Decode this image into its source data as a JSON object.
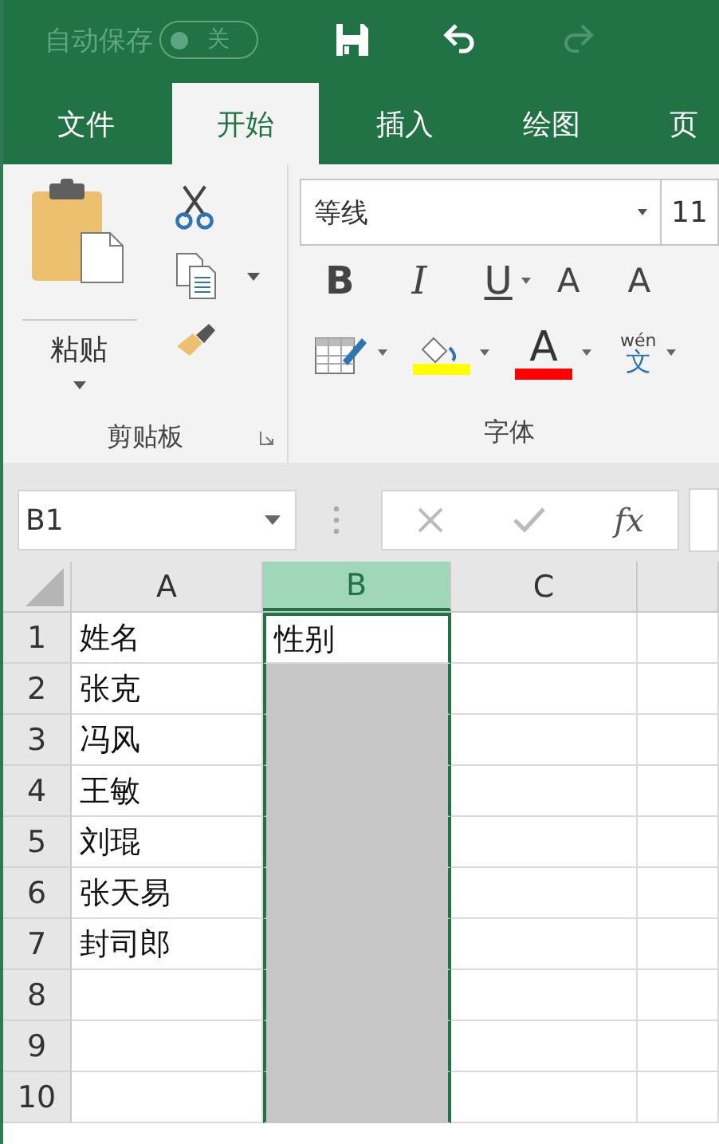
{
  "title_bar": {
    "autosave_label": "自动保存",
    "autosave_on": false,
    "autosave_state": "关",
    "redo_disabled": true
  },
  "tabs": [
    {
      "label": "文件",
      "selected": false
    },
    {
      "label": "开始",
      "selected": true
    },
    {
      "label": "插入",
      "selected": false
    },
    {
      "label": "绘图",
      "selected": false
    },
    {
      "label": "页",
      "selected": false
    }
  ],
  "ribbon": {
    "clipboard": {
      "paste_label": "粘贴",
      "group_label": "剪贴板"
    },
    "font": {
      "font_name": "等线",
      "font_size": "11",
      "bold": "B",
      "italic": "I",
      "underline": "U",
      "grow": "A",
      "shrink": "A",
      "phonetic_top": "wén",
      "phonetic_bottom": "文",
      "font_color_glyph": "A",
      "group_label": "字体",
      "swatches": [
        {
          "kind": "fill",
          "color": "#ffff00"
        },
        {
          "kind": "font",
          "color": "#ff0000"
        }
      ]
    }
  },
  "formula_bar": {
    "name_box": "B1",
    "fx": "fx"
  },
  "columns": [
    {
      "label": "A",
      "selected": false
    },
    {
      "label": "B",
      "selected": true
    },
    {
      "label": "C",
      "selected": false
    }
  ],
  "rows": [
    {
      "number": "1",
      "cells": [
        {
          "text": "姓名",
          "selected": false
        },
        {
          "text": "性别",
          "selected": true
        }
      ]
    },
    {
      "number": "2",
      "cells": [
        {
          "text": "张克",
          "selected": false
        }
      ]
    },
    {
      "number": "3",
      "cells": [
        {
          "text": "冯风",
          "selected": false
        }
      ]
    },
    {
      "number": "4",
      "cells": [
        {
          "text": "王敏",
          "selected": false
        }
      ]
    },
    {
      "number": "5",
      "cells": [
        {
          "text": "刘琨",
          "selected": false
        }
      ]
    },
    {
      "number": "6",
      "cells": [
        {
          "text": "张天易",
          "selected": false
        }
      ]
    },
    {
      "number": "7",
      "cells": [
        {
          "text": "封司郎",
          "selected": false
        }
      ]
    },
    {
      "number": "8",
      "cells": []
    },
    {
      "number": "9",
      "cells": []
    },
    {
      "number": "10",
      "cells": []
    }
  ]
}
